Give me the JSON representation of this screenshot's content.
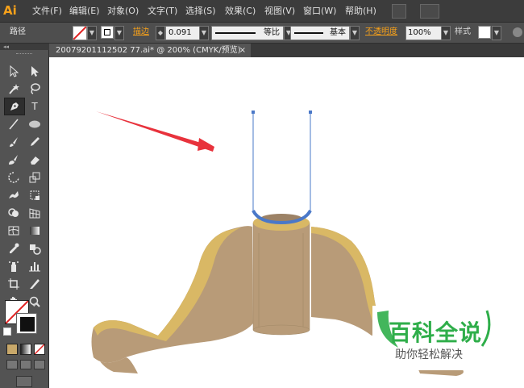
{
  "app": {
    "logo": "Ai"
  },
  "menu": {
    "items": [
      "文件(F)",
      "编辑(E)",
      "对象(O)",
      "文字(T)",
      "选择(S)",
      "效果(C)",
      "视图(V)",
      "窗口(W)",
      "帮助(H)"
    ]
  },
  "control_bar": {
    "selection_label": "路径",
    "stroke_label": "描边",
    "stroke_value": "0.091",
    "profile_label": "等比",
    "brush_label": "基本",
    "opacity_label": "不透明度",
    "opacity_value": "100%",
    "style_label": "样式"
  },
  "document": {
    "tab_title": "20079201112502 77.ai* @ 200% (CMYK/预览)",
    "close_glyph": "×"
  },
  "tools": {
    "type_glyph": "T"
  },
  "watermark": {
    "title": "百科全说",
    "subtitle": "助你轻松解决"
  },
  "colors": {
    "accent": "#f7a11a",
    "path_blue": "#4a78c8",
    "arrow_red": "#e8323c",
    "wood_top": "#d9b865",
    "wood_body": "#b89b78",
    "watermark_green": "#2fae4a"
  }
}
